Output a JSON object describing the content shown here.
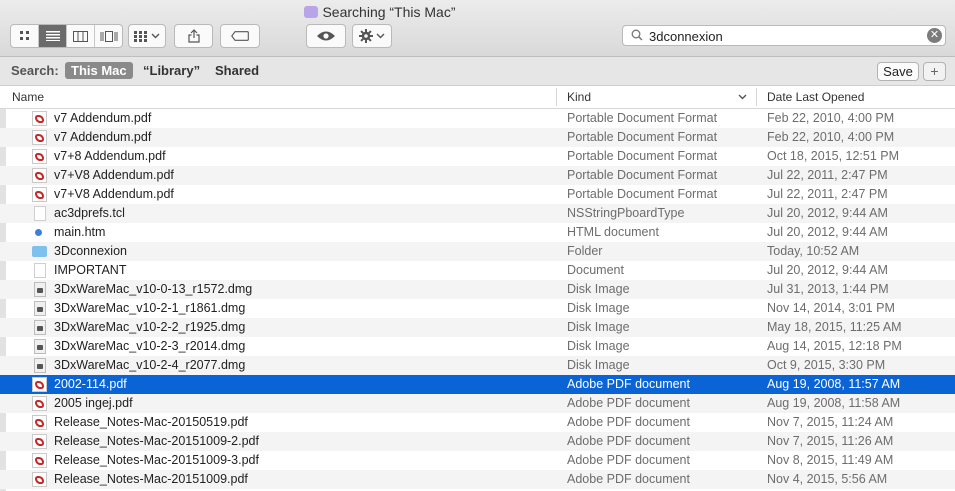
{
  "window": {
    "title": "Searching “This Mac”"
  },
  "toolbar": {
    "view_buttons": [
      "icon-view-icon",
      "list-view-icon",
      "column-view-icon",
      "coverflow-view-icon"
    ],
    "arrange_icon": "grid-icon",
    "share_icon": "share-icon",
    "tag_icon": "tag-icon",
    "quicklook_icon": "eye-icon",
    "action_icon": "gear-icon"
  },
  "search": {
    "value": "3dconnexion"
  },
  "scope": {
    "label": "Search:",
    "options": [
      "This Mac",
      "“Library”",
      "Shared"
    ],
    "active": "This Mac",
    "save_label": "Save",
    "add_label": "+"
  },
  "columns": {
    "name": "Name",
    "kind": "Kind",
    "date": "Date Last Opened"
  },
  "files": [
    {
      "name": "v7 Addendum.pdf",
      "kind": "Portable Document Format",
      "date": "Feb 22, 2010, 4:00 PM",
      "icon": "pdf"
    },
    {
      "name": "v7 Addendum.pdf",
      "kind": "Portable Document Format",
      "date": "Feb 22, 2010, 4:00 PM",
      "icon": "pdf"
    },
    {
      "name": "v7+8 Addendum.pdf",
      "kind": "Portable Document Format",
      "date": "Oct 18, 2015, 12:51 PM",
      "icon": "pdf"
    },
    {
      "name": "v7+V8 Addendum.pdf",
      "kind": "Portable Document Format",
      "date": "Jul 22, 2011, 2:47 PM",
      "icon": "pdf"
    },
    {
      "name": "v7+V8 Addendum.pdf",
      "kind": "Portable Document Format",
      "date": "Jul 22, 2011, 2:47 PM",
      "icon": "pdf"
    },
    {
      "name": "ac3dprefs.tcl",
      "kind": "NSStringPboardType",
      "date": "Jul 20, 2012, 9:44 AM",
      "icon": "doc"
    },
    {
      "name": "main.htm",
      "kind": "HTML document",
      "date": "Jul 20, 2012, 9:44 AM",
      "icon": "html"
    },
    {
      "name": "3Dconnexion",
      "kind": "Folder",
      "date": "Today, 10:52 AM",
      "icon": "folder"
    },
    {
      "name": "IMPORTANT",
      "kind": "Document",
      "date": "Jul 20, 2012, 9:44 AM",
      "icon": "doc"
    },
    {
      "name": "3DxWareMac_v10-0-13_r1572.dmg",
      "kind": "Disk Image",
      "date": "Jul 31, 2013, 1:44 PM",
      "icon": "dmg"
    },
    {
      "name": "3DxWareMac_v10-2-1_r1861.dmg",
      "kind": "Disk Image",
      "date": "Nov 14, 2014, 3:01 PM",
      "icon": "dmg"
    },
    {
      "name": "3DxWareMac_v10-2-2_r1925.dmg",
      "kind": "Disk Image",
      "date": "May 18, 2015, 11:25 AM",
      "icon": "dmg"
    },
    {
      "name": "3DxWareMac_v10-2-3_r2014.dmg",
      "kind": "Disk Image",
      "date": "Aug 14, 2015, 12:18 PM",
      "icon": "dmg"
    },
    {
      "name": "3DxWareMac_v10-2-4_r2077.dmg",
      "kind": "Disk Image",
      "date": "Oct 9, 2015, 3:30 PM",
      "icon": "dmg"
    },
    {
      "name": "2002-114.pdf",
      "kind": "Adobe PDF document",
      "date": "Aug 19, 2008, 11:57 AM",
      "icon": "pdf",
      "selected": true
    },
    {
      "name": "2005 ingej.pdf",
      "kind": "Adobe PDF document",
      "date": "Aug 19, 2008, 11:58 AM",
      "icon": "pdf"
    },
    {
      "name": "Release_Notes-Mac-20150519.pdf",
      "kind": "Adobe PDF document",
      "date": "Nov 7, 2015, 11:24 AM",
      "icon": "pdf"
    },
    {
      "name": "Release_Notes-Mac-20151009-2.pdf",
      "kind": "Adobe PDF document",
      "date": "Nov 7, 2015, 11:26 AM",
      "icon": "pdf"
    },
    {
      "name": "Release_Notes-Mac-20151009-3.pdf",
      "kind": "Adobe PDF document",
      "date": "Nov 8, 2015, 11:49 AM",
      "icon": "pdf"
    },
    {
      "name": "Release_Notes-Mac-20151009.pdf",
      "kind": "Adobe PDF document",
      "date": "Nov 4, 2015, 5:56 AM",
      "icon": "pdf"
    }
  ]
}
